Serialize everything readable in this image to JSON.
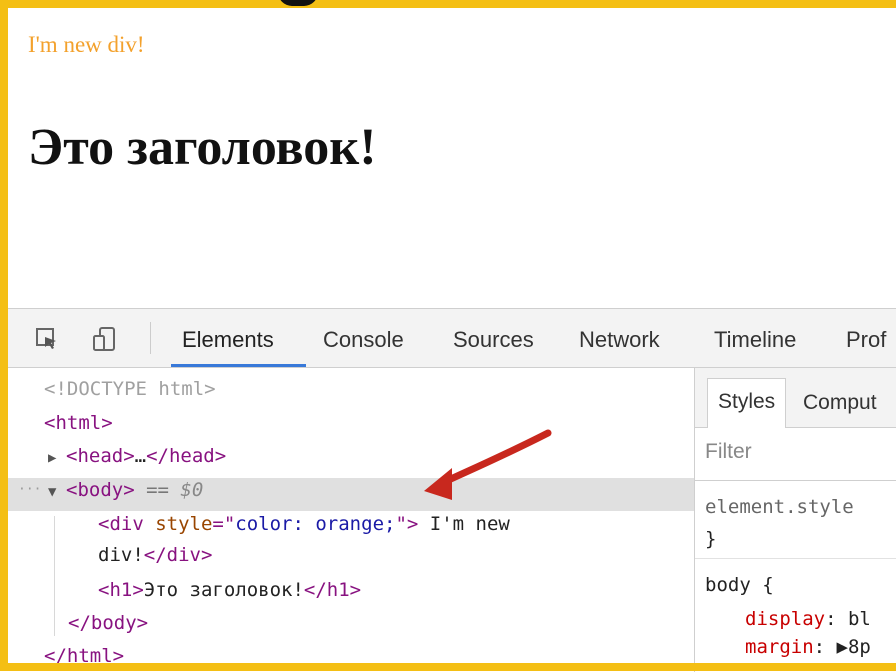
{
  "page": {
    "orange_text": "I'm new div!",
    "heading": "Это заголовок!"
  },
  "devtools": {
    "tabs": [
      "Elements",
      "Console",
      "Sources",
      "Network",
      "Timeline",
      "Prof"
    ],
    "active_tab": "Elements",
    "dom": {
      "doctype": "<!DOCTYPE html>",
      "html_open": "<html>",
      "head_open": "<head>",
      "head_ellipsis": "…",
      "head_close": "</head>",
      "body_open": "<body>",
      "body_eq": " == ",
      "body_var": "$0",
      "div_open_tag": "<div",
      "div_attr_name": " style",
      "div_attr_eq": "=\"",
      "div_attr_value": "color: orange;",
      "div_attr_close": "\">",
      "div_text_1": " I'm new",
      "div_text_2": "div!",
      "div_close": "</div>",
      "h1_open": "<h1>",
      "h1_text": "Это заголовок!",
      "h1_close": "</h1>",
      "body_close": "</body>",
      "html_close": "</html>"
    },
    "styles": {
      "tabs": [
        "Styles",
        "Comput"
      ],
      "filter_placeholder": "Filter",
      "element_style": "element.style",
      "close_brace": "}",
      "body_rule": "body {",
      "display_prop": "display",
      "display_val": ": bl",
      "margin_prop": "margin",
      "margin_val": ": ▶8p"
    }
  },
  "colors": {
    "frame": "#f4bf14",
    "orange_text": "#f3a12c",
    "active_tab_underline": "#3879d9",
    "arrow": "#c8281e"
  },
  "icons": [
    "inspect-element-icon",
    "device-mode-icon",
    "annotation-arrow-icon"
  ]
}
